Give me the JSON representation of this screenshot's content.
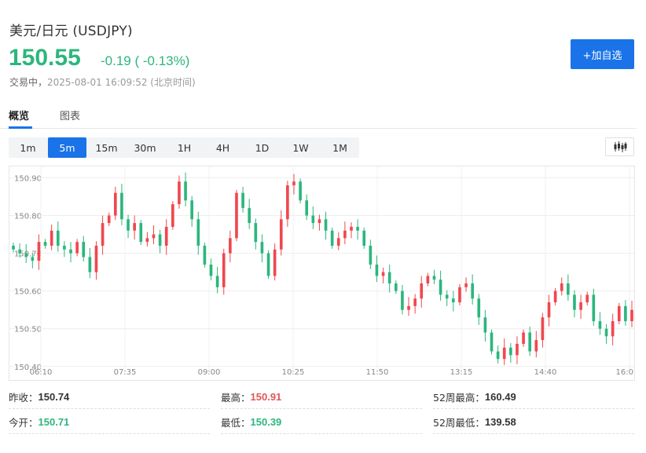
{
  "header": {
    "title": "美元/日元  (USDJPY)",
    "price": "150.55",
    "change": "-0.19 ( -0.13%)",
    "status": "交易中，",
    "timestamp": "2025-08-01 16:09:52 (北京时间)",
    "add_button_label": "+加自选"
  },
  "tabs": [
    "概览",
    "图表"
  ],
  "periods": [
    "1m",
    "5m",
    "15m",
    "30m",
    "1H",
    "4H",
    "1D",
    "1W",
    "1M"
  ],
  "active_period": "5m",
  "stats": {
    "prev_close_label": "昨收：",
    "prev_close": "150.74",
    "open_label": "今开：",
    "open": "150.71",
    "high_label": "最高：",
    "high": "150.91",
    "low_label": "最低：",
    "low": "150.39",
    "w52_high_label": "52周最高：",
    "w52_high": "160.49",
    "w52_low_label": "52周最低：",
    "w52_low": "139.58"
  },
  "colors": {
    "up": "#f0474f",
    "down": "#2cb67d",
    "accent": "#1a73e8"
  },
  "icons": {
    "chart_type_toggle": "candlestick-icon"
  },
  "chart_data": {
    "type": "candlestick",
    "y_ticks": [
      150.9,
      150.8,
      150.7,
      150.6,
      150.5,
      150.4
    ],
    "ylim": [
      150.385,
      150.93
    ],
    "x_ticks": [
      "06:10",
      "07:35",
      "09:00",
      "10:25",
      "11:50",
      "13:15",
      "14:40",
      "16:0"
    ],
    "grid": true,
    "close_path": [
      150.71,
      150.7,
      150.69,
      150.68,
      150.73,
      150.72,
      150.76,
      150.72,
      150.71,
      150.7,
      150.73,
      150.69,
      150.65,
      150.72,
      150.78,
      150.8,
      150.86,
      150.79,
      150.76,
      150.78,
      150.73,
      150.74,
      150.75,
      150.72,
      150.77,
      150.83,
      150.89,
      150.84,
      150.79,
      150.72,
      150.67,
      150.64,
      150.61,
      150.7,
      150.74,
      150.86,
      150.82,
      150.78,
      150.73,
      150.7,
      150.64,
      150.71,
      150.79,
      150.88,
      150.89,
      150.84,
      150.8,
      150.78,
      150.79,
      150.76,
      150.72,
      150.74,
      150.76,
      150.77,
      150.76,
      150.72,
      150.67,
      150.64,
      150.65,
      150.62,
      150.6,
      150.55,
      150.56,
      150.58,
      150.62,
      150.64,
      150.63,
      150.59,
      150.58,
      150.57,
      150.61,
      150.62,
      150.58,
      150.53,
      150.49,
      150.44,
      150.42,
      150.45,
      150.43,
      150.46,
      150.49,
      150.44,
      150.47,
      150.53,
      150.57,
      150.6,
      150.62,
      150.59,
      150.55,
      150.57,
      150.59,
      150.52,
      150.5,
      150.48,
      150.52,
      150.56,
      150.52,
      150.55
    ]
  }
}
